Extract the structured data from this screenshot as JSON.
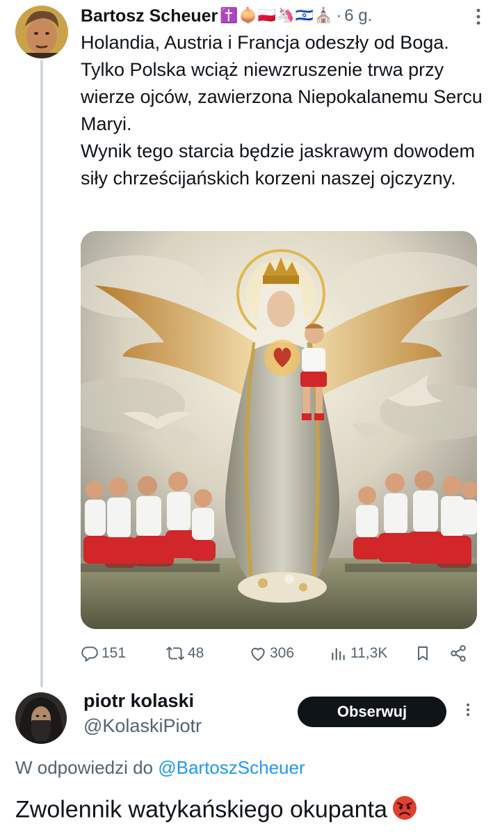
{
  "tweet": {
    "author_name": "Bartosz Scheuer",
    "name_emojis": "✝️🧅🇵🇱🦄🇮🇱⛪",
    "dot": "·",
    "time": "6 g.",
    "text": "Holandia, Austria i Francja odeszły od Boga. Tylko Polska wciąż niewzruszenie trwa przy wierze ojców, zawierzona Niepokalanemu Sercu Maryi.\nWynik tego starcia będzie jaskrawym dowodem siły chrześcijańskich korzeni naszej ojczyzny.",
    "image_icon": "illustration-madonna-with-angel-wings-and-kneeling-footballers",
    "stats": {
      "replies": "151",
      "reposts": "48",
      "likes": "306",
      "views": "11,3K"
    }
  },
  "reply": {
    "author_name": "piotr kolaski",
    "handle": "@KolaskiPiotr",
    "follow_label": "Obserwuj",
    "in_reply_prefix": "W odpowiedzi do",
    "in_reply_mention": "@BartoszScheuer",
    "text": "Zwolennik watykańskiego okupanta"
  },
  "colors": {
    "text": "#0f1419",
    "secondary": "#536471",
    "link": "#1d9bf0",
    "follow_bg": "#0f1419",
    "thread_line": "#cfd9de"
  }
}
